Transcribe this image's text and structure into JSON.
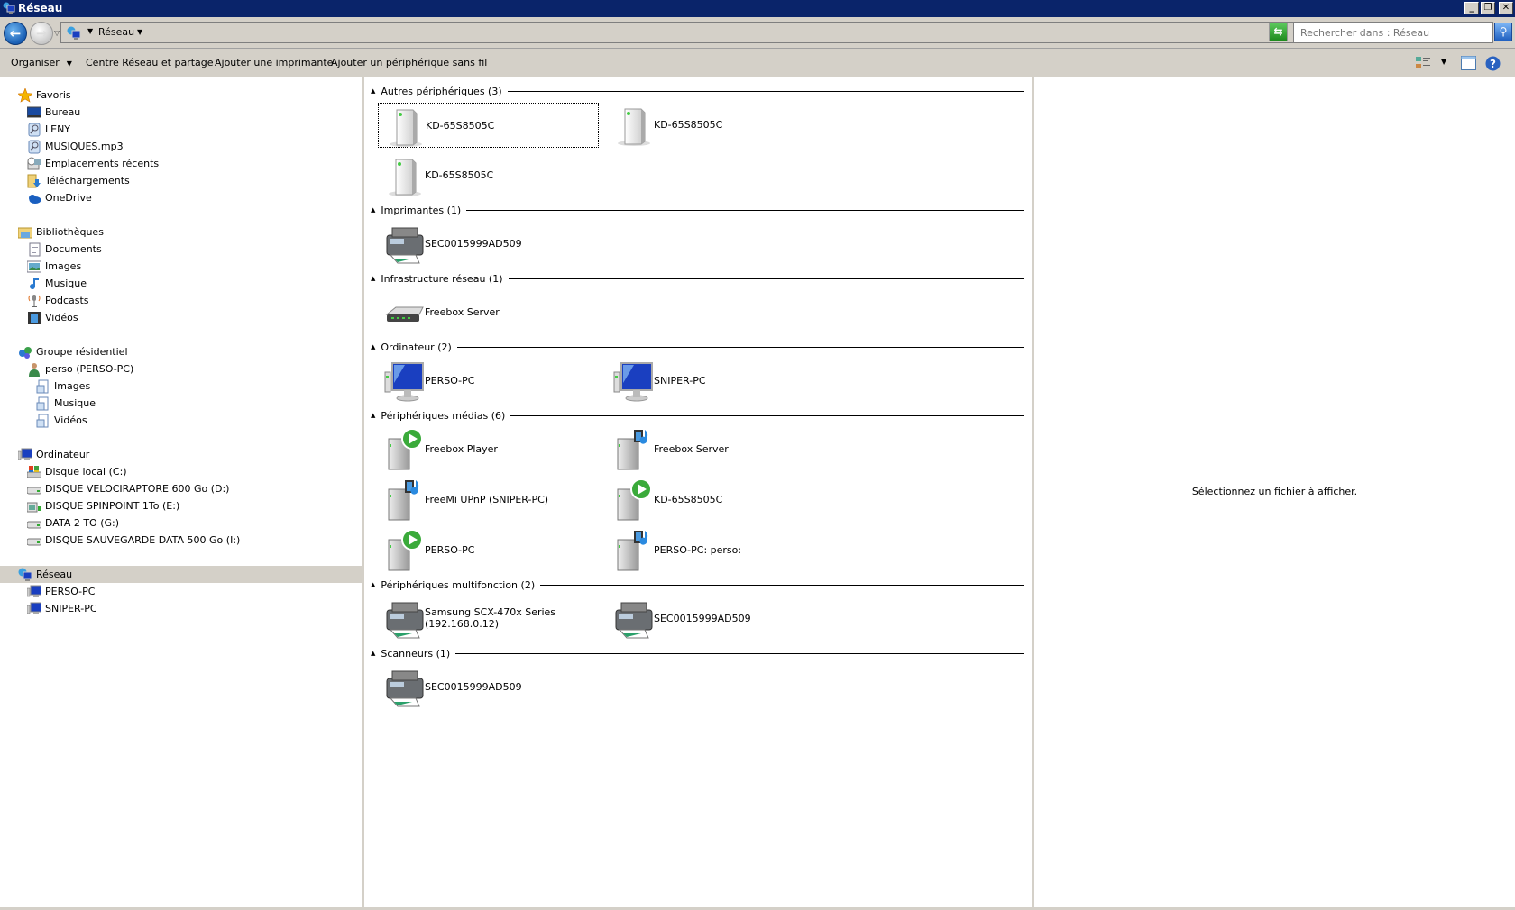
{
  "window": {
    "title": "Réseau",
    "controls": [
      "_",
      "❐",
      "✕"
    ]
  },
  "address": {
    "breadcrumb": "Réseau",
    "search_placeholder": "Rechercher dans : Réseau"
  },
  "toolbar": {
    "organize": "Organiser",
    "network_center": "Centre Réseau et partage",
    "add_printer": "Ajouter une imprimante",
    "add_wireless": "Ajouter un périphérique sans fil"
  },
  "nav_tree": [
    {
      "label": "Favoris",
      "level": 0,
      "icon": "star"
    },
    {
      "label": "Bureau",
      "level": 1,
      "icon": "desktop"
    },
    {
      "label": "LENY",
      "level": 1,
      "icon": "search-folder"
    },
    {
      "label": "MUSIQUES.mp3",
      "level": 1,
      "icon": "search-folder"
    },
    {
      "label": "Emplacements récents",
      "level": 1,
      "icon": "recent"
    },
    {
      "label": "Téléchargements",
      "level": 1,
      "icon": "downloads"
    },
    {
      "label": "OneDrive",
      "level": 1,
      "icon": "cloud"
    },
    {
      "gap": true
    },
    {
      "label": "Bibliothèques",
      "level": 0,
      "icon": "library"
    },
    {
      "label": "Documents",
      "level": 1,
      "icon": "document"
    },
    {
      "label": "Images",
      "level": 1,
      "icon": "image"
    },
    {
      "label": "Musique",
      "level": 1,
      "icon": "music"
    },
    {
      "label": "Podcasts",
      "level": 1,
      "icon": "podcast"
    },
    {
      "label": "Vidéos",
      "level": 1,
      "icon": "video"
    },
    {
      "gap": true
    },
    {
      "label": "Groupe résidentiel",
      "level": 0,
      "icon": "homegroup"
    },
    {
      "label": "perso (PERSO-PC)",
      "level": 1,
      "icon": "user"
    },
    {
      "label": "Images",
      "level": 2,
      "icon": "shared-library"
    },
    {
      "label": "Musique",
      "level": 2,
      "icon": "shared-library"
    },
    {
      "label": "Vidéos",
      "level": 2,
      "icon": "shared-library"
    },
    {
      "gap": true
    },
    {
      "label": "Ordinateur",
      "level": 0,
      "icon": "computer"
    },
    {
      "label": "Disque local (C:)",
      "level": 1,
      "icon": "system-drive"
    },
    {
      "label": "DISQUE VELOCIRAPTORE 600 Go (D:)",
      "level": 1,
      "icon": "drive"
    },
    {
      "label": "DISQUE SPINPOINT 1To (E:)",
      "level": 1,
      "icon": "drive-image"
    },
    {
      "label": "DATA 2 TO (G:)",
      "level": 1,
      "icon": "drive"
    },
    {
      "label": "DISQUE SAUVEGARDE DATA 500 Go (I:)",
      "level": 1,
      "icon": "drive"
    },
    {
      "gap": true
    },
    {
      "label": "Réseau",
      "level": 0,
      "icon": "network",
      "selected": true
    },
    {
      "label": "PERSO-PC",
      "level": 1,
      "icon": "computer"
    },
    {
      "label": "SNIPER-PC",
      "level": 1,
      "icon": "computer"
    }
  ],
  "groups": [
    {
      "title": "Autres périphériques (3)",
      "items": [
        {
          "label": "KD-65S8505C",
          "icon": "device",
          "selected": true
        },
        {
          "label": "KD-65S8505C",
          "icon": "device"
        },
        {
          "label": "KD-65S8505C",
          "icon": "device"
        }
      ]
    },
    {
      "title": "Imprimantes (1)",
      "items": [
        {
          "label": "SEC0015999AD509",
          "icon": "printer"
        }
      ]
    },
    {
      "title": "Infrastructure réseau (1)",
      "items": [
        {
          "label": "Freebox Server",
          "icon": "router"
        }
      ]
    },
    {
      "title": "Ordinateur (2)",
      "items": [
        {
          "label": "PERSO-PC",
          "icon": "monitor"
        },
        {
          "label": "SNIPER-PC",
          "icon": "monitor"
        }
      ]
    },
    {
      "title": "Périphériques médias (6)",
      "items": [
        {
          "label": "Freebox Player",
          "icon": "media-player"
        },
        {
          "label": "Freebox Server",
          "icon": "media-server"
        },
        {
          "label": "FreeMi UPnP (SNIPER-PC)",
          "icon": "media-server"
        },
        {
          "label": "KD-65S8505C",
          "icon": "media-player"
        },
        {
          "label": "PERSO-PC",
          "icon": "media-player"
        },
        {
          "label": "PERSO-PC: perso:",
          "icon": "media-server"
        }
      ]
    },
    {
      "title": "Périphériques multifonction (2)",
      "items": [
        {
          "label": "Samsung SCX-470x Series\n(192.168.0.12)",
          "icon": "printer"
        },
        {
          "label": "SEC0015999AD509",
          "icon": "printer"
        }
      ]
    },
    {
      "title": "Scanneurs (1)",
      "items": [
        {
          "label": "SEC0015999AD509",
          "icon": "printer"
        }
      ]
    }
  ],
  "preview": {
    "message": "Sélectionnez un fichier à afficher."
  },
  "colors": {
    "titlebar": "#0a246a",
    "chrome": "#d4d0c8",
    "accent": "#1a5fb4"
  }
}
